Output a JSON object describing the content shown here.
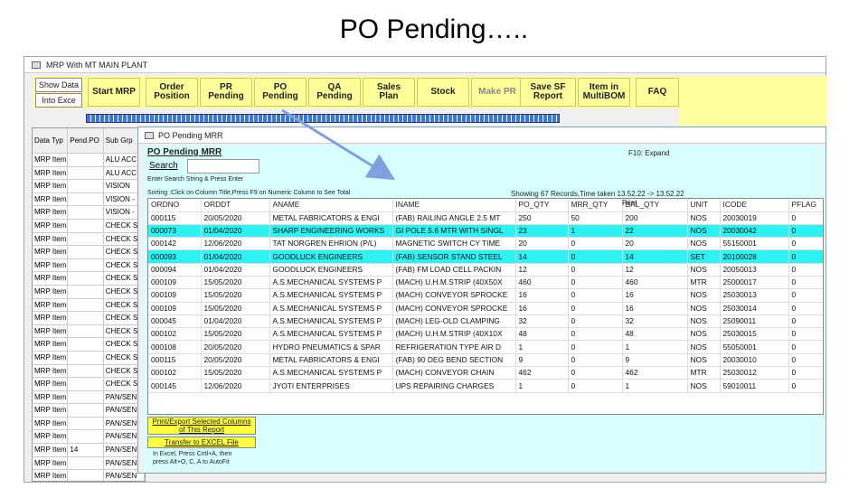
{
  "slide": {
    "title": "PO Pending….."
  },
  "main_window": {
    "title": "MRP With MT MAIN PLANT"
  },
  "toolbar": {
    "show_data": "Show Data",
    "into_excel": "Into Exce",
    "buttons": [
      "Start MRP",
      "Order\nPosition",
      "PR\nPending",
      "PO\nPending",
      "QA\nPending",
      "Sales\nPlan",
      "Stock",
      "Make PR",
      "Save SF\nReport",
      "Item in\nMultiBOM",
      "FAQ"
    ]
  },
  "left_grid": {
    "columns": [
      "Data Typ",
      "Pend.PO",
      "Sub Grp"
    ],
    "rows": [
      [
        "MRP Item",
        "",
        "ALU ACC"
      ],
      [
        "MRP Item",
        "",
        "ALU ACC"
      ],
      [
        "MRP Item",
        "",
        "VISION"
      ],
      [
        "MRP Item",
        "",
        "VISION -"
      ],
      [
        "MRP Item",
        "",
        "VISION -"
      ],
      [
        "MRP Item",
        "",
        "CHECK S"
      ],
      [
        "MRP Item",
        "",
        "CHECK S"
      ],
      [
        "MRP Item",
        "",
        "CHECK S"
      ],
      [
        "MRP Item",
        "",
        "CHECK S"
      ],
      [
        "MRP Item",
        "",
        "CHECK S"
      ],
      [
        "MRP Item",
        "",
        "CHECK S"
      ],
      [
        "MRP Item",
        "",
        "CHECK S"
      ],
      [
        "MRP Item",
        "",
        "CHECK S"
      ],
      [
        "MRP Item",
        "",
        "CHECK S"
      ],
      [
        "MRP Item",
        "",
        "CHECK S"
      ],
      [
        "MRP Item",
        "",
        "CHECK S"
      ],
      [
        "MRP Item",
        "",
        "CHECK S"
      ],
      [
        "MRP Item",
        "",
        "CHECK S"
      ],
      [
        "MRP Item",
        "",
        "PAN/SEN"
      ],
      [
        "MRP Item",
        "",
        "PAN/SEN"
      ],
      [
        "MRP Item",
        "",
        "PAN/SEN"
      ],
      [
        "MRP Item",
        "",
        "PAN/SEN"
      ],
      [
        "MRP Item",
        "14",
        "PAN/SEN"
      ],
      [
        "MRP Item",
        "",
        "PAN/SEN"
      ],
      [
        "MRP Item",
        "",
        "PAN/SEN"
      ]
    ]
  },
  "po_window": {
    "title": "PO Pending MRR",
    "heading": "PO Pending MRR",
    "f10": "F10: Expand",
    "search_label": "Search",
    "search_value": "",
    "hint_enter": "Enter Search String & Press Enter",
    "hint_sort": "Sorting :Click on Column Title,Press F9 on Numeric Column to See Total",
    "records": "Showing 67 Records,Time taken 13.52.22 -> 13.52.22",
    "print_label": "Print",
    "columns": [
      "ORDNO",
      "ORDDT",
      "ANAME",
      "INAME",
      "PO_QTY",
      "MRR_QTY",
      "BAL_QTY",
      "UNIT",
      "ICODE",
      "PFLAG"
    ],
    "rows": [
      [
        "000115",
        "20/05/2020",
        "METAL FABRICATORS & ENGI",
        "(FAB) RAILING ANGLE 2.5 MT",
        "250",
        "50",
        "200",
        "NOS",
        "20030019",
        "0"
      ],
      [
        "000073",
        "01/04/2020",
        "SHARP ENGINEERING WORKS",
        "GI POLE 5.6 MTR WITH SINGL",
        "23",
        "1",
        "22",
        "NOS",
        "20030042",
        "0"
      ],
      [
        "000142",
        "12/06/2020",
        "TAT NORGREN EHRION (P/L)",
        "MAGNETIC SWITCH CY TIME",
        "20",
        "0",
        "20",
        "NOS",
        "55150001",
        "0"
      ],
      [
        "000093",
        "01/04/2020",
        "GOODLUCK ENGINEERS",
        "(FAB) SENSOR STAND STEEL",
        "14",
        "0",
        "14",
        "SET",
        "20100028",
        "0"
      ],
      [
        "000094",
        "01/04/2020",
        "GOODLUCK ENGINEERS",
        "(FAB) FM LOAD CELL PACKIN",
        "12",
        "0",
        "12",
        "NOS",
        "20050013",
        "0"
      ],
      [
        "000109",
        "15/05/2020",
        "A.S.MECHANICAL SYSTEMS P",
        "(MACH) U.H.M.STRIP (40X50X",
        "460",
        "0",
        "460",
        "MTR",
        "25000017",
        "0"
      ],
      [
        "000109",
        "15/05/2020",
        "A.S.MECHANICAL SYSTEMS P",
        "(MACH) CONVEYOR SPROCKE",
        "16",
        "0",
        "16",
        "NOS",
        "25030013",
        "0"
      ],
      [
        "000109",
        "15/05/2020",
        "A.S.MECHANICAL SYSTEMS P",
        "(MACH) CONVEYOR SPROCKE",
        "16",
        "0",
        "16",
        "NOS",
        "25030014",
        "0"
      ],
      [
        "000045",
        "01/04/2020",
        "A.S.MECHANICAL SYSTEMS P",
        "(MACH) LEG-OLD CLAMPING",
        "32",
        "0",
        "32",
        "NOS",
        "25090011",
        "0"
      ],
      [
        "000102",
        "15/05/2020",
        "A.S.MECHANICAL SYSTEMS P",
        "(MACH) U.H.M.STRIP (40X10X",
        "48",
        "0",
        "48",
        "NOS",
        "25030015",
        "0"
      ],
      [
        "000108",
        "20/05/2020",
        "HYDRO PNEUMATICS & SPAR",
        "REFRIGERATION TYPE AIR D",
        "1",
        "0",
        "1",
        "NOS",
        "55050001",
        "0"
      ],
      [
        "000115",
        "20/05/2020",
        "METAL FABRICATORS & ENGI",
        "(FAB) 90 DEG BEND SECTION",
        "9",
        "0",
        "9",
        "NOS",
        "20030010",
        "0"
      ],
      [
        "000102",
        "15/05/2020",
        "A.S.MECHANICAL SYSTEMS P",
        "(MACH) CONVEYOR CHAIN",
        "462",
        "0",
        "462",
        "MTR",
        "25030012",
        "0"
      ],
      [
        "000145",
        "12/06/2020",
        "JYOTI ENTERPRISES",
        "UPS REPAIRING CHARGES",
        "1",
        "0",
        "1",
        "NOS",
        "59010011",
        "0"
      ]
    ],
    "highlight_rows": [
      1,
      3
    ],
    "btn_print": "Print/Export Selected Columns\nof This Report",
    "btn_excel": "Transfer to EXCEL File",
    "excel_hint": "In Excel, Press Cntl+A, then\npress Alt+O, C, A to AutoFit"
  },
  "colors": {
    "toolbar": "#ffffa0",
    "highlight": "#2ef2f2",
    "arrow": "#7fa0e0",
    "panel": "#d8ffff"
  }
}
